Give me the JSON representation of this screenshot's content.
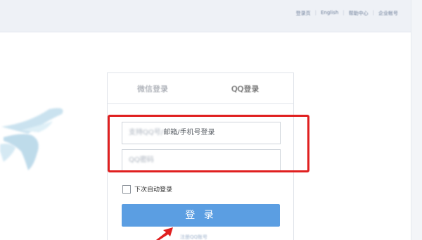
{
  "header": {
    "links": [
      "登录页",
      "English",
      "帮助中心",
      "企业帐号"
    ]
  },
  "tabs": {
    "wechat": "微信登录",
    "qq": "QQ登录"
  },
  "account_field": {
    "placeholder_blurred": "支持QQ号/",
    "placeholder_visible": "邮箱/手机号登录"
  },
  "password_field": {
    "placeholder": "QQ密码"
  },
  "auto_login": {
    "label": "下次自动登录"
  },
  "login_button": {
    "label": "登 录"
  },
  "bottom_link": "注册QQ账号",
  "colors": {
    "accent": "#5b9ee2",
    "highlight": "#e02020"
  }
}
